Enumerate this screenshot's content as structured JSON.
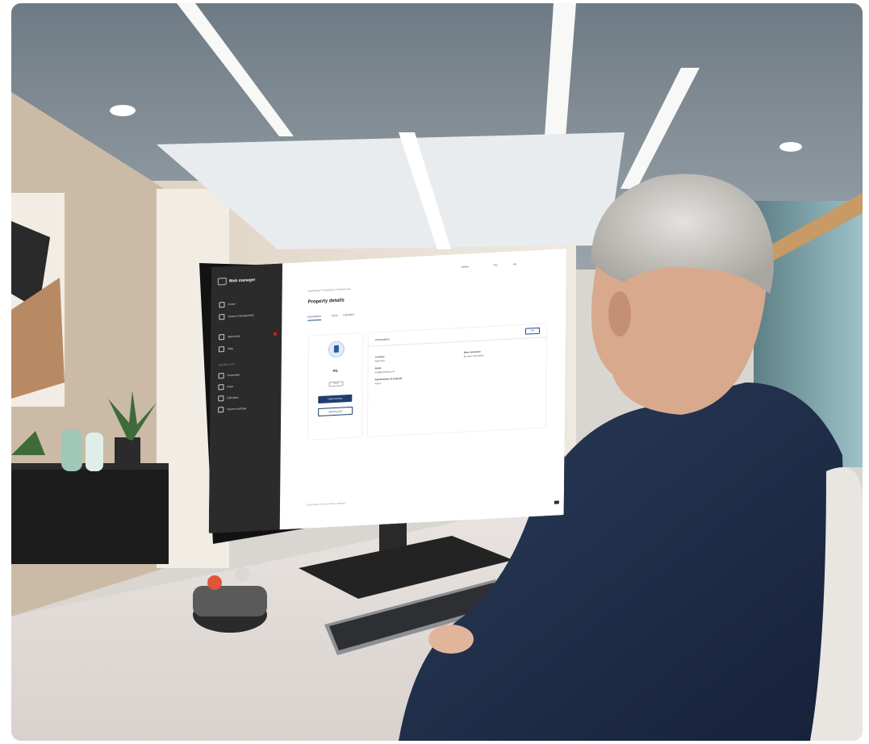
{
  "app": {
    "name": "Web manager"
  },
  "sidebar": {
    "items": [
      {
        "label": "Home",
        "icon": "home-icon"
      },
      {
        "label": "System management",
        "icon": "system-icon"
      },
      {
        "label": "Approvals",
        "icon": "clipboard-icon"
      },
      {
        "label": "Help",
        "icon": "help-icon"
      }
    ],
    "section_label": "SHORTCUTS",
    "shortcuts": [
      {
        "label": "Properties",
        "icon": "building-icon"
      },
      {
        "label": "Keys",
        "icon": "key-icon"
      },
      {
        "label": "Cylinders",
        "icon": "lock-icon"
      },
      {
        "label": "System settings",
        "icon": "gear-icon"
      }
    ]
  },
  "topbar": {
    "status": "Online",
    "user_a": "PG",
    "user_b": "AA"
  },
  "main": {
    "breadcrumb": "Dashboard / Properties / Winslow Ave",
    "title": "Property details",
    "tabs": [
      "Information",
      "Keys",
      "Cylinders"
    ],
    "property": {
      "name": "PG",
      "chip": "Active",
      "primary_button": "Hand out key",
      "secondary_button": "Add key slot"
    },
    "info": {
      "title": "Information",
      "edit_label": "Edit",
      "fields": [
        {
          "label": "Location",
          "value": "Main floor"
        },
        {
          "label": "Email",
          "value": "mail@example.com"
        },
        {
          "label": "Administrator of property",
          "value": "Admin"
        }
      ],
      "right_field": {
        "label": "Main contractor",
        "value": "By other information"
      }
    },
    "footer": "© 2024 ABLOY  |  Terms  |  Privacy statement"
  },
  "colors": {
    "sidebar": "#2b2b2b",
    "accent": "#1f3e6e",
    "badge": "#d21f1f"
  }
}
